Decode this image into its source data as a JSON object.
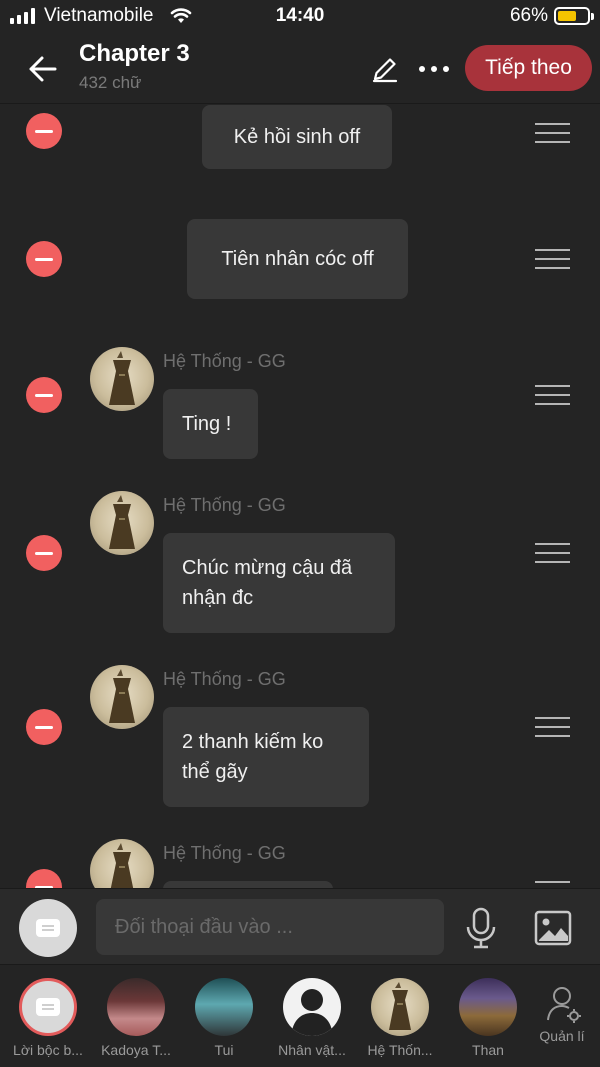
{
  "status_bar": {
    "carrier": "Vietnamobile",
    "time": "14:40",
    "battery_percent": "66%",
    "battery_level": 0.66
  },
  "header": {
    "title": "Chapter 3",
    "word_count": "432 chữ",
    "next_label": "Tiếp theo"
  },
  "messages": [
    {
      "type": "narration",
      "text": "Kẻ hồi sinh off"
    },
    {
      "type": "narration",
      "text": "Tiên nhân cóc off"
    },
    {
      "type": "character",
      "sender": "Hệ Thống - GG",
      "text": "Ting !"
    },
    {
      "type": "character",
      "sender": "Hệ Thống - GG",
      "text": "Chúc mừng cậu đã nhận đc"
    },
    {
      "type": "character",
      "sender": "Hệ Thống - GG",
      "text": "2 thanh kiếm ko thể gãy"
    },
    {
      "type": "character",
      "sender": "Hệ Thống - GG",
      "text": ""
    }
  ],
  "composer": {
    "placeholder": "Đối thoại đầu vào ..."
  },
  "characters": [
    {
      "label": "Lời bộc b...",
      "selected": true
    },
    {
      "label": "Kadoya T..."
    },
    {
      "label": "Tui"
    },
    {
      "label": "Nhân vật..."
    },
    {
      "label": "Hệ Thốn..."
    },
    {
      "label": "Than"
    }
  ],
  "manage_label": "Quản lí",
  "colors": {
    "background": "#242424",
    "bubble": "#383838",
    "accent": "#a8333b",
    "delete": "#f16060"
  }
}
